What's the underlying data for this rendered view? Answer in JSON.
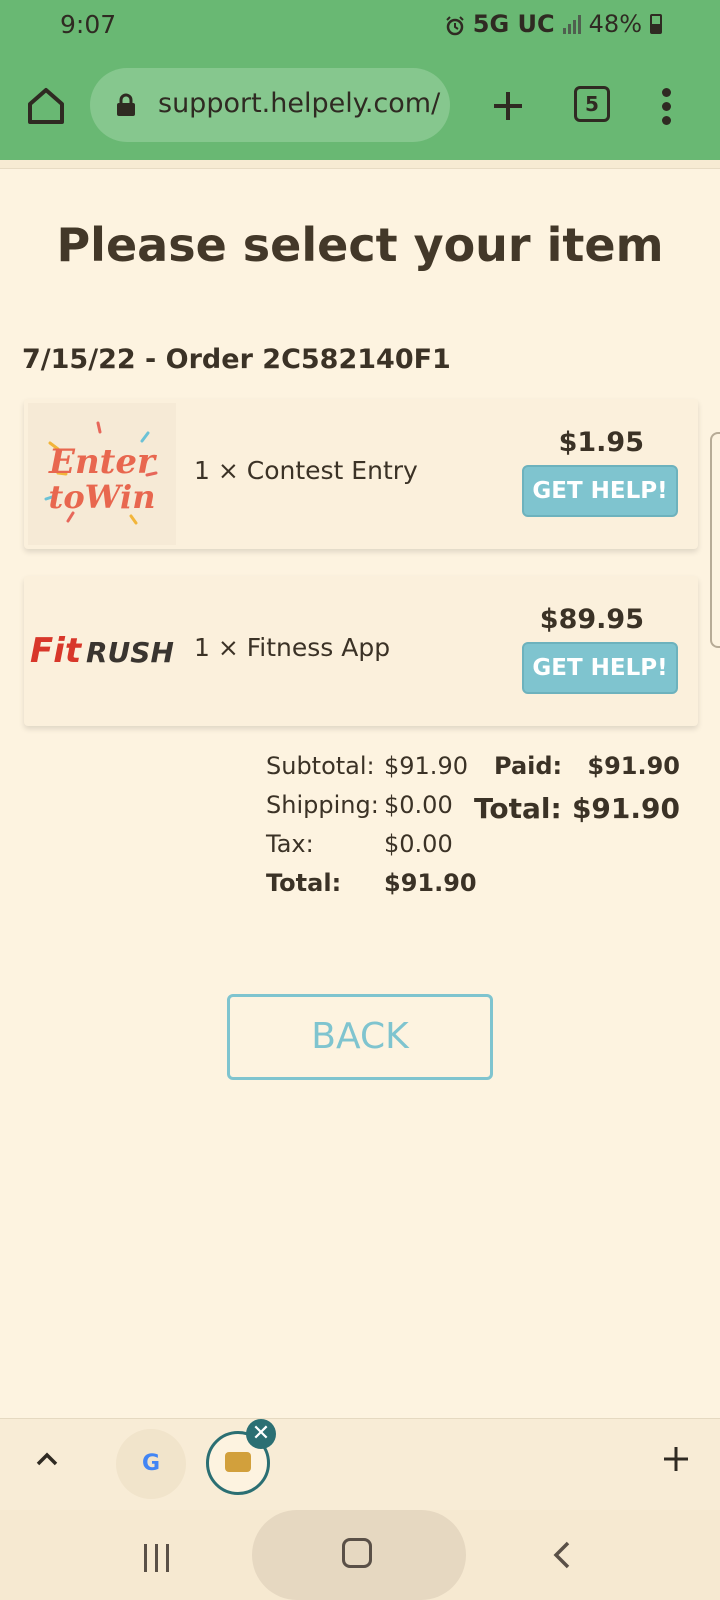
{
  "status_bar": {
    "time": "9:07",
    "network": "5G UC",
    "battery": "48%",
    "battery_level": 0.48,
    "icons": [
      "alarm-icon",
      "signal-icon",
      "battery-icon"
    ]
  },
  "browser": {
    "url": "support.helpely.com/",
    "tab_count": "5",
    "icons": [
      "home-icon",
      "lock-icon",
      "plus-icon",
      "tabs-icon",
      "overflow-menu-icon"
    ]
  },
  "page": {
    "title": "Please select your item",
    "order_heading": "7/15/22 - Order 2C582140F1",
    "items": [
      {
        "name": "1 × Contest Entry",
        "price": "$1.95",
        "button": "GET HELP!",
        "thumbnail": "Enter to Win"
      },
      {
        "name": "1 × Fitness App",
        "price": "$89.95",
        "button": "GET HELP!",
        "thumbnail": "FitRush"
      }
    ],
    "totals": {
      "subtotal_label": "Subtotal:",
      "subtotal": "$91.90",
      "shipping_label": "Shipping:",
      "shipping": "$0.00",
      "tax_label": "Tax:",
      "tax": "$0.00",
      "total_label": "Total:",
      "total": "$91.90",
      "paid_label": "Paid:",
      "paid": "$91.90",
      "grand_label": "Total:",
      "grand": "$91.90"
    },
    "back_button": "BACK"
  },
  "tab_strip": {
    "google_tab": "G",
    "close": "✕"
  },
  "colors": {
    "chrome": "#69b873",
    "background": "#fdf3e0",
    "accent": "#7fc4cf",
    "text": "#3b3226"
  }
}
